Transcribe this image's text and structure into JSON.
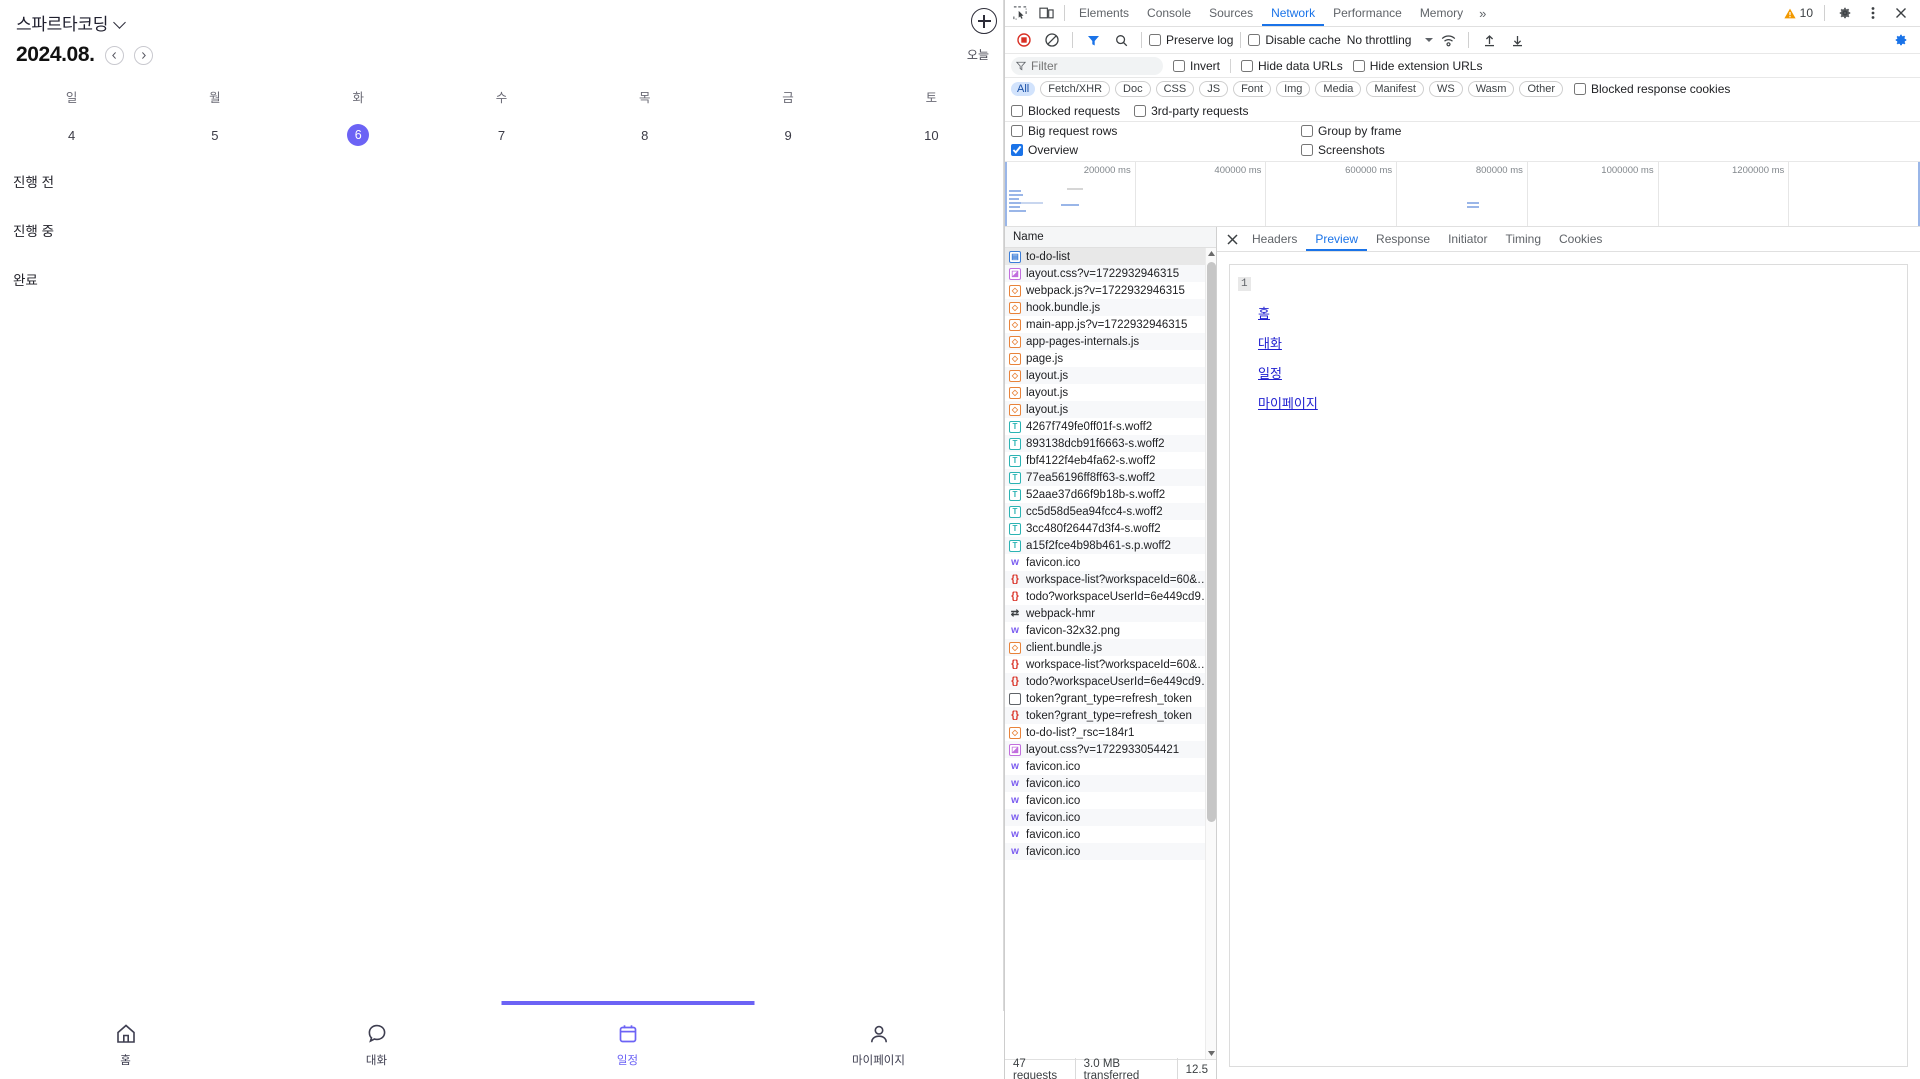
{
  "app": {
    "workspace_name": "스파르타코딩",
    "workspace_chevron": "chevron-down-icon",
    "month_label": "2024.08.",
    "prev_label": "‹",
    "next_label": "›",
    "today_button": "오늘",
    "add_button": "plus-icon",
    "weekdays": [
      "일",
      "월",
      "화",
      "수",
      "목",
      "금",
      "토"
    ],
    "dates": [
      "4",
      "5",
      "6",
      "7",
      "8",
      "9",
      "10"
    ],
    "active_date": "6",
    "status_sections": [
      "진행 전",
      "진행 중",
      "완료"
    ],
    "bottom_nav": [
      {
        "label": "홈",
        "icon": "home-icon",
        "active": false
      },
      {
        "label": "대화",
        "icon": "chat-bubble-icon",
        "active": false
      },
      {
        "label": "일정",
        "icon": "calendar-icon",
        "active": true
      },
      {
        "label": "마이페이지",
        "icon": "person-icon",
        "active": false
      }
    ],
    "accent_color": "#6c63f5"
  },
  "devtools": {
    "tabs": [
      {
        "label": "Elements",
        "selected": false
      },
      {
        "label": "Console",
        "selected": false
      },
      {
        "label": "Sources",
        "selected": false
      },
      {
        "label": "Network",
        "selected": true
      },
      {
        "label": "Performance",
        "selected": false
      },
      {
        "label": "Memory",
        "selected": false
      }
    ],
    "more_tabs": "»",
    "warning_count": "10",
    "settings_icon": "gear-icon",
    "kebab_icon": "more-vertical-icon",
    "close_icon": "close-icon",
    "inspect_icon": "inspect-element-icon",
    "device_icon": "device-toolbar-icon",
    "toolbar": {
      "record_icon": "record-stop-icon",
      "clear_icon": "clear-network-icon",
      "filter_icon": "filter-icon",
      "search_icon": "search-icon",
      "preserve_log": "Preserve log",
      "preserve_log_checked": false,
      "disable_cache": "Disable cache",
      "disable_cache_checked": false,
      "throttling": "No throttling",
      "wifi_icon": "network-conditions-icon",
      "import_icon": "import-har-icon",
      "export_icon": "export-har-icon",
      "network_settings_icon": "network-settings-gear-icon"
    },
    "filterbar": {
      "placeholder": "Filter",
      "invert": "Invert",
      "invert_checked": false,
      "hide_data_urls": "Hide data URLs",
      "hide_data_urls_checked": false,
      "hide_extension_urls": "Hide extension URLs",
      "hide_extension_urls_checked": false
    },
    "type_chips": [
      "All",
      "Fetch/XHR",
      "Doc",
      "CSS",
      "JS",
      "Font",
      "Img",
      "Media",
      "Manifest",
      "WS",
      "Wasm",
      "Other"
    ],
    "type_chip_selected": "All",
    "blocked_response_cookies": "Blocked response cookies",
    "blocked_requests": "Blocked requests",
    "third_party_requests": "3rd-party requests",
    "settings_rows": [
      {
        "label": "Big request rows",
        "checked": false
      },
      {
        "label": "Group by frame",
        "checked": false
      },
      {
        "label": "Overview",
        "checked": true
      },
      {
        "label": "Screenshots",
        "checked": false
      }
    ],
    "overview_ticks": [
      "200000 ms",
      "400000 ms",
      "600000 ms",
      "800000 ms",
      "1000000 ms",
      "1200000 ms"
    ],
    "request_column_header": "Name",
    "requests": [
      {
        "name": "to-do-list",
        "type": "doc",
        "glyph": "▤",
        "selected": true
      },
      {
        "name": "layout.css?v=1722932946315",
        "type": "css",
        "glyph": "◪"
      },
      {
        "name": "webpack.js?v=1722932946315",
        "type": "js",
        "glyph": "◇"
      },
      {
        "name": "hook.bundle.js",
        "type": "js",
        "glyph": "◇"
      },
      {
        "name": "main-app.js?v=1722932946315",
        "type": "js",
        "glyph": "◇"
      },
      {
        "name": "app-pages-internals.js",
        "type": "js",
        "glyph": "◇"
      },
      {
        "name": "page.js",
        "type": "js",
        "glyph": "◇"
      },
      {
        "name": "layout.js",
        "type": "js",
        "glyph": "◇"
      },
      {
        "name": "layout.js",
        "type": "js",
        "glyph": "◇"
      },
      {
        "name": "layout.js",
        "type": "js",
        "glyph": "◇"
      },
      {
        "name": "4267f749fe0ff01f-s.woff2",
        "type": "font",
        "glyph": "T"
      },
      {
        "name": "893138dcb91f6663-s.woff2",
        "type": "font",
        "glyph": "T"
      },
      {
        "name": "fbf4122f4eb4fa62-s.woff2",
        "type": "font",
        "glyph": "T"
      },
      {
        "name": "77ea56196ff8ff63-s.woff2",
        "type": "font",
        "glyph": "T"
      },
      {
        "name": "52aae37d66f9b18b-s.woff2",
        "type": "font",
        "glyph": "T"
      },
      {
        "name": "cc5d58d5ea94fcc4-s.woff2",
        "type": "font",
        "glyph": "T"
      },
      {
        "name": "3cc480f26447d3f4-s.woff2",
        "type": "font",
        "glyph": "T"
      },
      {
        "name": "a15f2fce4b98b461-s.p.woff2",
        "type": "font",
        "glyph": "T"
      },
      {
        "name": "favicon.ico",
        "type": "img",
        "glyph": "w"
      },
      {
        "name": "workspace-list?workspaceId=60&…",
        "type": "xhr",
        "glyph": "{}"
      },
      {
        "name": "todo?workspaceUserId=6e449cd9…",
        "type": "xhr",
        "glyph": "{}"
      },
      {
        "name": "webpack-hmr",
        "type": "ws",
        "glyph": "⇄"
      },
      {
        "name": "favicon-32x32.png",
        "type": "img",
        "glyph": "w"
      },
      {
        "name": "client.bundle.js",
        "type": "js",
        "glyph": "◇"
      },
      {
        "name": "workspace-list?workspaceId=60&…",
        "type": "xhr",
        "glyph": "{}"
      },
      {
        "name": "todo?workspaceUserId=6e449cd9…",
        "type": "xhr",
        "glyph": "{}"
      },
      {
        "name": "token?grant_type=refresh_token",
        "type": "other",
        "glyph": ""
      },
      {
        "name": "token?grant_type=refresh_token",
        "type": "xhr",
        "glyph": "{}"
      },
      {
        "name": "to-do-list?_rsc=184r1",
        "type": "js",
        "glyph": "◇"
      },
      {
        "name": "layout.css?v=1722933054421",
        "type": "css",
        "glyph": "◪"
      },
      {
        "name": "favicon.ico",
        "type": "img",
        "glyph": "w"
      },
      {
        "name": "favicon.ico",
        "type": "img",
        "glyph": "w"
      },
      {
        "name": "favicon.ico",
        "type": "img",
        "glyph": "w"
      },
      {
        "name": "favicon.ico",
        "type": "img",
        "glyph": "w"
      },
      {
        "name": "favicon.ico",
        "type": "img",
        "glyph": "w"
      },
      {
        "name": "favicon.ico",
        "type": "img",
        "glyph": "w"
      }
    ],
    "status_bar": [
      "47 requests",
      "3.0 MB transferred",
      "12.5"
    ],
    "detail_tabs": [
      {
        "label": "Headers",
        "selected": false
      },
      {
        "label": "Preview",
        "selected": true
      },
      {
        "label": "Response",
        "selected": false
      },
      {
        "label": "Initiator",
        "selected": false
      },
      {
        "label": "Timing",
        "selected": false
      },
      {
        "label": "Cookies",
        "selected": false
      }
    ],
    "preview": {
      "line_number": "1",
      "links": [
        "홈",
        "대화",
        "일정",
        "마이페이지"
      ]
    }
  }
}
